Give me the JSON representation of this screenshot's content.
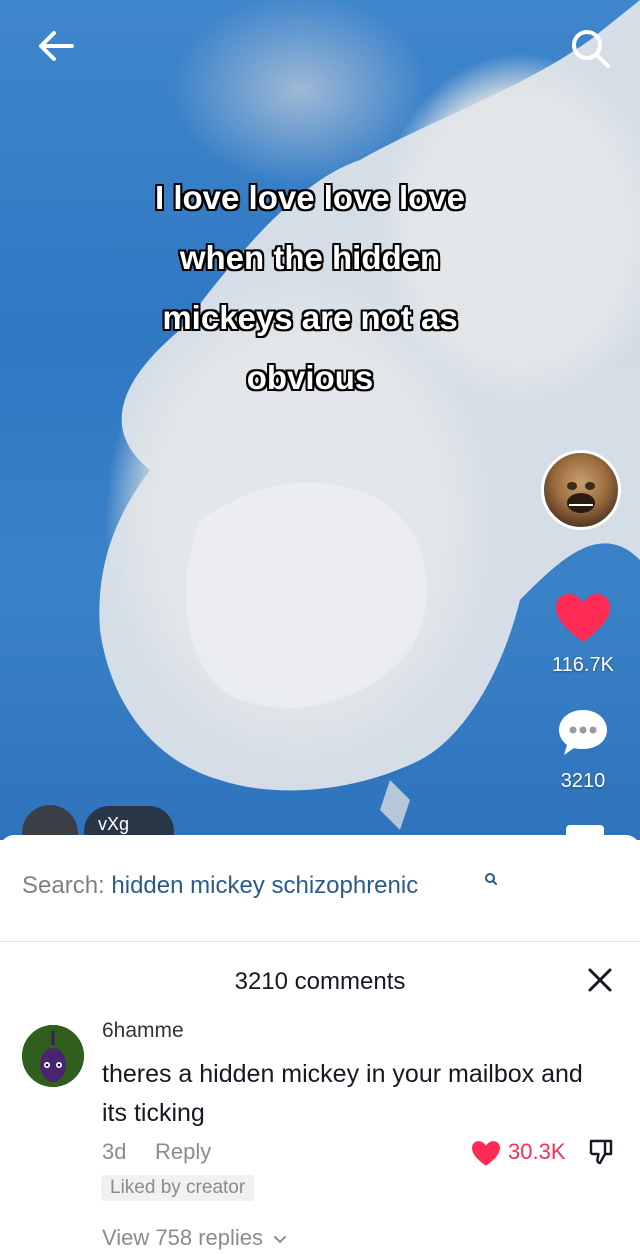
{
  "video": {
    "caption_lines": [
      "I love love love love",
      "when the hidden",
      "mickeys are not as",
      "obvious"
    ],
    "like_count": "116.7K",
    "comment_count": "3210",
    "partial_text": "vXg"
  },
  "icons": {
    "back": "back-arrow-icon",
    "search": "search-icon",
    "heart": "heart-icon",
    "comment": "comment-bubble-icon"
  },
  "search_suggestion": {
    "prefix": "Search: ",
    "term": "hidden mickey schizophrenic"
  },
  "comments_panel": {
    "title": "3210 comments",
    "close": "close-icon"
  },
  "comment": {
    "username": "6hamme",
    "text": "theres a hidden mickey in your mailbox and its ticking",
    "age": "3d",
    "reply_label": "Reply",
    "like_count": "30.3K",
    "liked_by_creator": "Liked by creator",
    "view_replies": "View 758 replies"
  },
  "colors": {
    "accent_red": "#fe2c55",
    "search_term_blue": "#2a5a8e",
    "video_blue": "#3a82c8"
  }
}
